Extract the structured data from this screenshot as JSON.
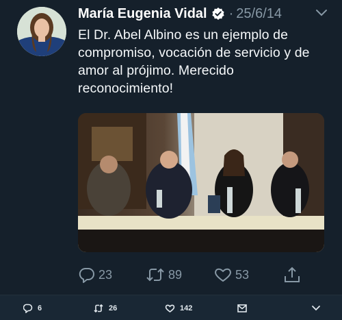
{
  "tweet": {
    "author_name": "María Eugenia Vidal",
    "date": "25/6/14",
    "separator": "·",
    "text": "El Dr. Abel Albino es un ejemplo de compromiso, vocación de servicio y de amor al prójimo. Merecido reconocimiento!",
    "actions": {
      "replies": "23",
      "retweets": "89",
      "likes": "53"
    }
  },
  "bottom_bar": {
    "replies": "6",
    "retweets": "26",
    "likes": "142"
  },
  "icons": {
    "verified": "verified-badge-icon",
    "more": "chevron-down-icon",
    "reply": "reply-icon",
    "retweet": "retweet-icon",
    "like": "heart-icon",
    "share": "share-icon",
    "message": "envelope-icon"
  },
  "colors": {
    "background": "#15202b",
    "muted": "#8899a6",
    "accent": "#1da1f2"
  }
}
